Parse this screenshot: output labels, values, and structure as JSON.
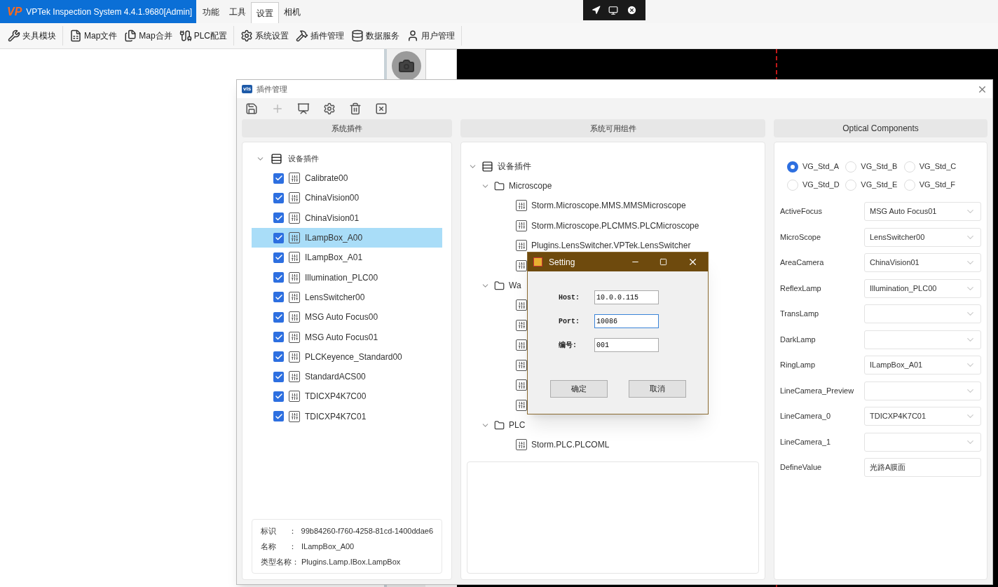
{
  "app": {
    "logo": "VP",
    "title": "VPTek Inspection System 4.4.1.9680[Admin]"
  },
  "menu": [
    {
      "label": "功能",
      "selected": false
    },
    {
      "label": "工具",
      "selected": false
    },
    {
      "label": "设置",
      "selected": true
    },
    {
      "label": "相机",
      "selected": false
    }
  ],
  "toolbar": [
    {
      "label": "夹具模块",
      "separator_after": true
    },
    {
      "label": "Map文件",
      "separator_after": false
    },
    {
      "label": "Map合并",
      "separator_after": false
    },
    {
      "label": "PLC配置",
      "separator_after": true
    },
    {
      "label": "系统设置",
      "separator_after": false
    },
    {
      "label": "插件管理",
      "separator_after": false
    },
    {
      "label": "数据服务",
      "separator_after": false
    },
    {
      "label": "用户管理",
      "separator_after": true
    }
  ],
  "plugin_manager": {
    "logo": "vis",
    "title": "插件管理",
    "tools": [
      {
        "kind": "save",
        "disabled": false
      },
      {
        "kind": "add",
        "disabled": true
      },
      {
        "kind": "device",
        "disabled": false
      },
      {
        "kind": "settings",
        "disabled": false
      },
      {
        "kind": "delete",
        "disabled": false
      },
      {
        "kind": "remove",
        "disabled": false
      }
    ],
    "column_headers": [
      "系统插件",
      "系统可用组件",
      "Optical Components"
    ],
    "system_plugins": {
      "label": "设备插件",
      "expanded": true,
      "children": [
        {
          "label": "Calibrate00",
          "checked": true,
          "selected": false
        },
        {
          "label": "ChinaVision00",
          "checked": true,
          "selected": false
        },
        {
          "label": "ChinaVision01",
          "checked": true,
          "selected": false
        },
        {
          "label": "ILampBox_A00",
          "checked": true,
          "selected": true
        },
        {
          "label": "ILampBox_A01",
          "checked": true,
          "selected": false
        },
        {
          "label": "Illumination_PLC00",
          "checked": true,
          "selected": false
        },
        {
          "label": "LensSwitcher00",
          "checked": true,
          "selected": false
        },
        {
          "label": "MSG Auto Focus00",
          "checked": true,
          "selected": false
        },
        {
          "label": "MSG Auto Focus01",
          "checked": true,
          "selected": false
        },
        {
          "label": "PLCKeyence_Standard00",
          "checked": true,
          "selected": false
        },
        {
          "label": "StandardACS00",
          "checked": true,
          "selected": false
        },
        {
          "label": "TDICXP4K7C00",
          "checked": true,
          "selected": false
        },
        {
          "label": "TDICXP4K7C01",
          "checked": true,
          "selected": false
        }
      ]
    },
    "details": [
      {
        "label": "标识",
        "sep": "：",
        "value": "99b84260-f760-4258-81cd-1400ddae6"
      },
      {
        "label": "名称",
        "sep": "：",
        "value": "ILampBox_A00"
      },
      {
        "label": "类型名称：",
        "value": "Plugins.Lamp.IBox.LampBox"
      }
    ],
    "available": {
      "label": "设备插件",
      "expanded": true,
      "children": [
        {
          "label": "Microscope",
          "expanded": true,
          "children": [
            {
              "label": "Storm.Microscope.MMS.MMSMicroscope"
            },
            {
              "label": "Storm.Microscope.PLCMMS.PLCMicroscope"
            },
            {
              "label": "Plugins.LensSwitcher.VPTek.LensSwitcher"
            },
            {
              "kind": "plugin"
            }
          ]
        },
        {
          "label": "Wa",
          "expanded": true,
          "children": [
            {
              "kind": "plugin"
            },
            {
              "kind": "plugin"
            },
            {
              "kind": "plugin"
            },
            {
              "kind": "plugin"
            },
            {
              "kind": "plugin"
            },
            {
              "kind": "plugin"
            }
          ]
        },
        {
          "label": "PLC",
          "expanded": true,
          "children": [
            {
              "label": "Storm.PLC.PLCOML"
            }
          ]
        }
      ]
    },
    "optical": {
      "presets": [
        {
          "label": "VG_Std_A",
          "selected": true
        },
        {
          "label": "VG_Std_B",
          "selected": false
        },
        {
          "label": "VG_Std_C",
          "selected": false
        },
        {
          "label": "VG_Std_D",
          "selected": false
        },
        {
          "label": "VG_Std_E",
          "selected": false
        },
        {
          "label": "VG_Std_F",
          "selected": false
        }
      ],
      "fields": [
        {
          "label": "ActiveFocus",
          "kind": "select",
          "value": "MSG Auto Focus01"
        },
        {
          "label": "MicroScope",
          "kind": "select",
          "value": "LensSwitcher00"
        },
        {
          "label": "AreaCamera",
          "kind": "select",
          "value": "ChinaVision01"
        },
        {
          "label": "ReflexLamp",
          "kind": "select",
          "value": "Illumination_PLC00"
        },
        {
          "label": "TransLamp",
          "kind": "select"
        },
        {
          "label": "DarkLamp",
          "kind": "select"
        },
        {
          "label": "RingLamp",
          "kind": "select",
          "value": "ILampBox_A01"
        },
        {
          "label": "LineCamera_Preview",
          "kind": "select"
        },
        {
          "label": "LineCamera_0",
          "kind": "select",
          "value": "TDICXP4K7C01"
        },
        {
          "label": "LineCamera_1",
          "kind": "select"
        },
        {
          "label": "DefineValue",
          "kind": "text",
          "value": "光路A膜面"
        }
      ]
    }
  },
  "setting_dialog": {
    "title": "Setting",
    "fields": [
      {
        "label": "Host:",
        "value": "10.0.0.115",
        "focused": false
      },
      {
        "label": "Port:",
        "value": "10086",
        "focused": true
      },
      {
        "label": "编号:",
        "value": "001",
        "focused": false
      }
    ],
    "buttons": [
      "确定",
      "取消"
    ]
  }
}
